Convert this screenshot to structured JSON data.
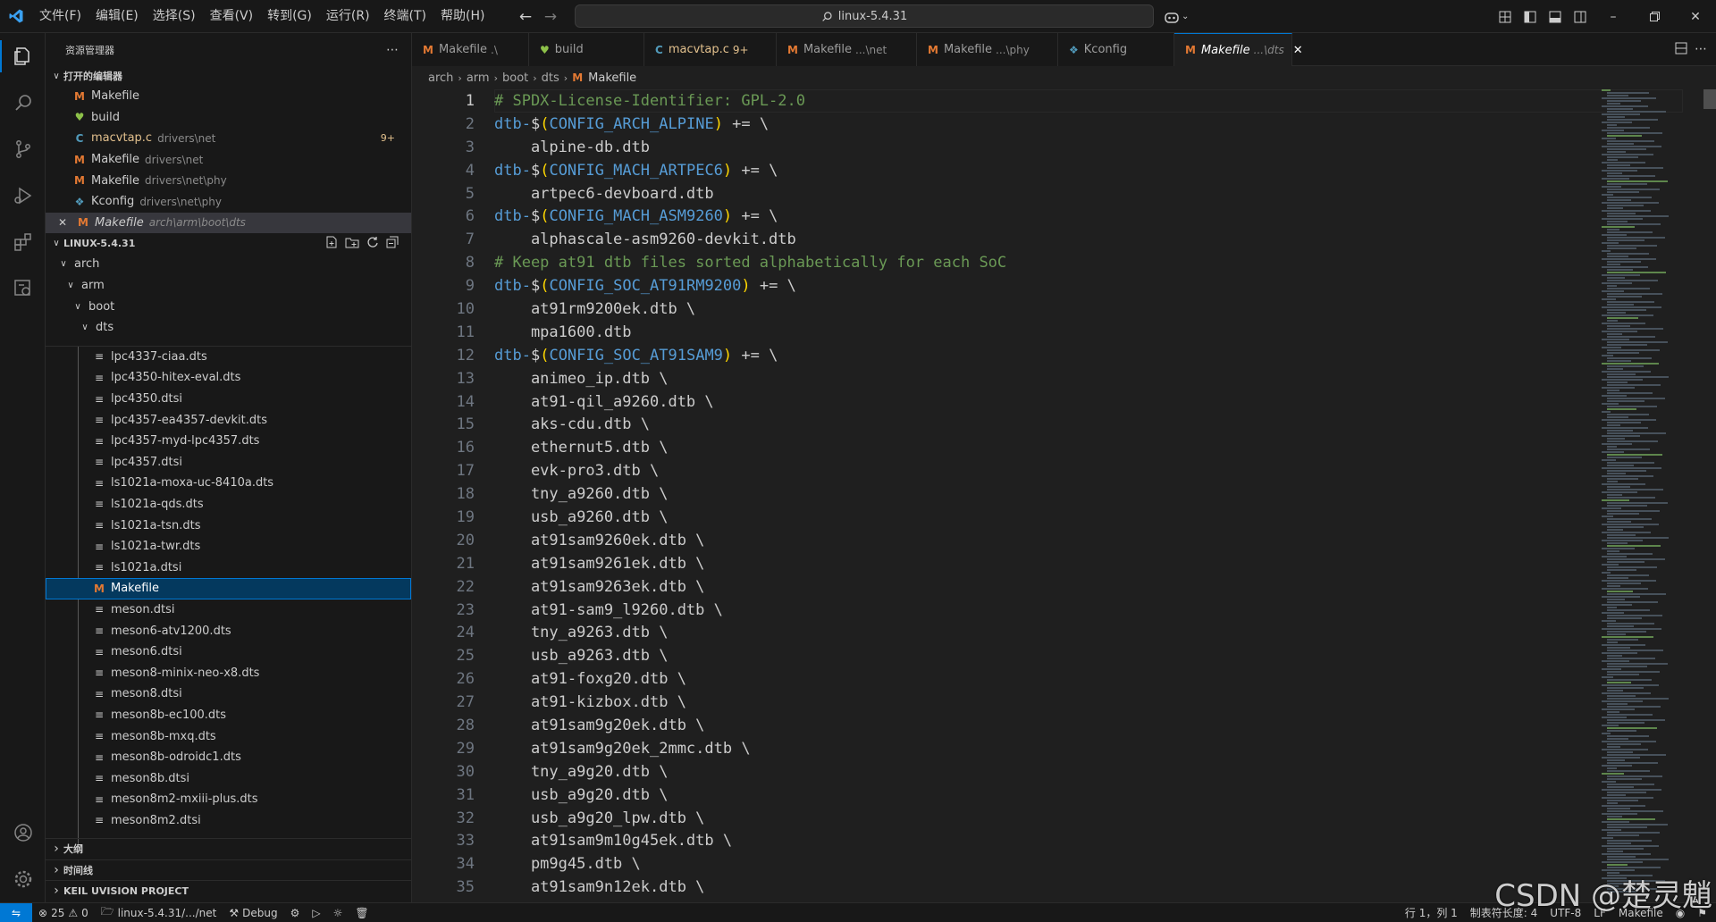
{
  "window": {
    "search_text": "linux-5.4.31",
    "menu": [
      "文件(F)",
      "编辑(E)",
      "选择(S)",
      "查看(V)",
      "转到(G)",
      "运行(R)",
      "终端(T)",
      "帮助(H)"
    ]
  },
  "sidebar": {
    "title": "资源管理器",
    "open_editors_title": "打开的编辑器",
    "open_editors": [
      {
        "icon": "M",
        "name": "Makefile",
        "desc": "",
        "badge": ""
      },
      {
        "icon": "heart",
        "name": "build",
        "desc": "",
        "badge": ""
      },
      {
        "icon": "C",
        "name": "macvtap.c",
        "desc": "drivers\\net",
        "badge": "9+"
      },
      {
        "icon": "M",
        "name": "Makefile",
        "desc": "drivers\\net",
        "badge": ""
      },
      {
        "icon": "M",
        "name": "Makefile",
        "desc": "drivers\\net\\phy",
        "badge": ""
      },
      {
        "icon": "K",
        "name": "Kconfig",
        "desc": "drivers\\net\\phy",
        "badge": ""
      },
      {
        "icon": "M",
        "name": "Makefile",
        "desc": "arch\\arm\\boot\\dts",
        "badge": ""
      }
    ],
    "project_title": "LINUX-5.4.31",
    "folders": [
      "arch",
      "arm",
      "boot",
      "dts"
    ],
    "files": [
      "lpc4337-ciaa.dts",
      "lpc4350-hitex-eval.dts",
      "lpc4350.dtsi",
      "lpc4357-ea4357-devkit.dts",
      "lpc4357-myd-lpc4357.dts",
      "lpc4357.dtsi",
      "ls1021a-moxa-uc-8410a.dts",
      "ls1021a-qds.dts",
      "ls1021a-tsn.dts",
      "ls1021a-twr.dts",
      "ls1021a.dtsi",
      "Makefile",
      "meson.dtsi",
      "meson6-atv1200.dts",
      "meson6.dtsi",
      "meson8-minix-neo-x8.dts",
      "meson8.dtsi",
      "meson8b-ec100.dts",
      "meson8b-mxq.dts",
      "meson8b-odroidc1.dts",
      "meson8b.dtsi",
      "meson8m2-mxiii-plus.dts",
      "meson8m2.dtsi"
    ],
    "bottom_sections": [
      "大纲",
      "时间线",
      "KEIL UVISION PROJECT"
    ]
  },
  "tabs": [
    {
      "icon": "M",
      "name": "Makefile",
      "desc": ".\\",
      "active": false
    },
    {
      "icon": "heart",
      "name": "build",
      "desc": "",
      "active": false
    },
    {
      "icon": "C",
      "name": "macvtap.c",
      "desc": "9+",
      "active": false
    },
    {
      "icon": "M",
      "name": "Makefile",
      "desc": "...\\net",
      "active": false
    },
    {
      "icon": "M",
      "name": "Makefile",
      "desc": "...\\phy",
      "active": false
    },
    {
      "icon": "K",
      "name": "Kconfig",
      "desc": "",
      "active": false
    },
    {
      "icon": "M",
      "name": "Makefile",
      "desc": "...\\dts",
      "active": true
    }
  ],
  "breadcrumb": [
    "arch",
    "arm",
    "boot",
    "dts",
    "Makefile"
  ],
  "editor": {
    "current_line": 1,
    "lines": [
      "# SPDX-License-Identifier: GPL-2.0",
      "dtb-$(CONFIG_ARCH_ALPINE) += \\",
      "    alpine-db.dtb",
      "dtb-$(CONFIG_MACH_ARTPEC6) += \\",
      "    artpec6-devboard.dtb",
      "dtb-$(CONFIG_MACH_ASM9260) += \\",
      "    alphascale-asm9260-devkit.dtb",
      "# Keep at91 dtb files sorted alphabetically for each SoC",
      "dtb-$(CONFIG_SOC_AT91RM9200) += \\",
      "    at91rm9200ek.dtb \\",
      "    mpa1600.dtb",
      "dtb-$(CONFIG_SOC_AT91SAM9) += \\",
      "    animeo_ip.dtb \\",
      "    at91-qil_a9260.dtb \\",
      "    aks-cdu.dtb \\",
      "    ethernut5.dtb \\",
      "    evk-pro3.dtb \\",
      "    tny_a9260.dtb \\",
      "    usb_a9260.dtb \\",
      "    at91sam9260ek.dtb \\",
      "    at91sam9261ek.dtb \\",
      "    at91sam9263ek.dtb \\",
      "    at91-sam9_l9260.dtb \\",
      "    tny_a9263.dtb \\",
      "    usb_a9263.dtb \\",
      "    at91-foxg20.dtb \\",
      "    at91-kizbox.dtb \\",
      "    at91sam9g20ek.dtb \\",
      "    at91sam9g20ek_2mmc.dtb \\",
      "    tny_a9g20.dtb \\",
      "    usb_a9g20.dtb \\",
      "    usb_a9g20_lpw.dtb \\",
      "    at91sam9m10g45ek.dtb \\",
      "    pm9g45.dtb \\",
      "    at91sam9n12ek.dtb \\"
    ]
  },
  "statusbar": {
    "errors": "25",
    "warnings": "0",
    "folder": "linux-5.4.31/.../net",
    "debug": "Debug",
    "position": "行 1，列 1",
    "tab_size": "制表符长度: 4",
    "encoding": "UTF-8",
    "eol": "LF",
    "language": "Makefile"
  },
  "watermark": "CSDN @楚灵魈",
  "colors": {
    "accent": "#0078d4",
    "comment": "#6a9955",
    "variable": "#569cd6",
    "makefile_icon": "#e37933"
  }
}
